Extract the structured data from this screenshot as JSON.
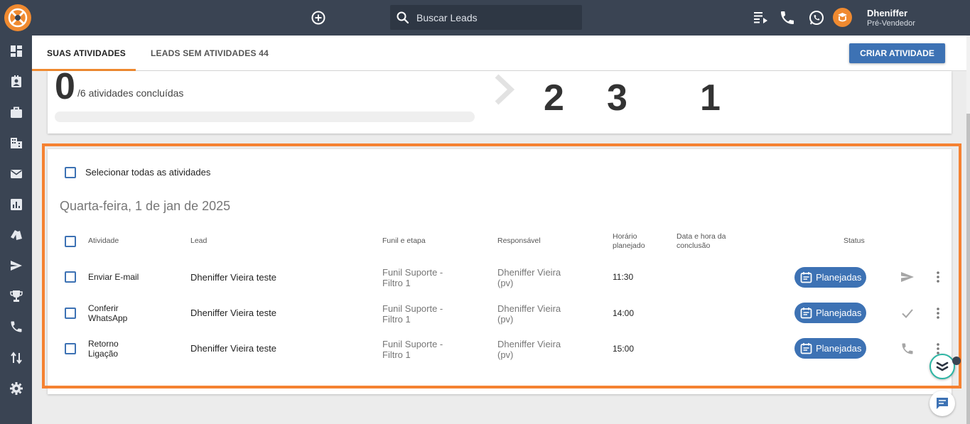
{
  "header": {
    "search_placeholder": "Buscar Leads",
    "user_name": "Dheniffer",
    "user_role": "Pré-Vendedor"
  },
  "sidebar": {
    "icons": [
      "dashboard-icon",
      "contacts-icon",
      "briefcase-icon",
      "building-icon",
      "mail-icon",
      "reports-icon",
      "tags-icon",
      "send-icon",
      "trophy-icon",
      "phone-icon",
      "transfer-icon",
      "settings-icon"
    ]
  },
  "tabs": {
    "activities": "SUAS ATIVIDADES",
    "leads_without": "LEADS SEM ATIVIDADES 44"
  },
  "create_button": "CRIAR ATIVIDADE",
  "summary": {
    "completed_count": "0",
    "completed_label": "/6 atividades concluídas",
    "progress_fraction": 0,
    "stats": [
      "2",
      "3",
      "1"
    ]
  },
  "list": {
    "select_all_label": "Selecionar todas as atividades",
    "date_heading": "Quarta-feira, 1 de jan de 2025",
    "columns": {
      "activity": "Atividade",
      "lead": "Lead",
      "funnel": "Funil e etapa",
      "owner": "Responsável",
      "planned_line1": "Horário",
      "planned_line2": "planejado",
      "completion_line1": "Data e hora da",
      "completion_line2": "conclusão",
      "status": "Status"
    },
    "rows": [
      {
        "activity_line1": "Enviar E-mail",
        "activity_line2": "",
        "lead": "Dheniffer Vieira teste",
        "funnel_line1": "Funil Suporte -",
        "funnel_line2": "Filtro 1",
        "owner_line1": "Dheniffer Vieira",
        "owner_line2": "(pv)",
        "time": "11:30",
        "status": "Planejadas",
        "action_icon": "send-icon"
      },
      {
        "activity_line1": "Conferir",
        "activity_line2": "WhatsApp",
        "lead": "Dheniffer Vieira teste",
        "funnel_line1": "Funil Suporte -",
        "funnel_line2": "Filtro 1",
        "owner_line1": "Dheniffer Vieira",
        "owner_line2": "(pv)",
        "time": "14:00",
        "status": "Planejadas",
        "action_icon": "check-icon"
      },
      {
        "activity_line1": "Retorno",
        "activity_line2": "Ligação",
        "lead": "Dheniffer Vieira teste",
        "funnel_line1": "Funil Suporte -",
        "funnel_line2": "Filtro 1",
        "owner_line1": "Dheniffer Vieira",
        "owner_line2": "(pv)",
        "time": "15:00",
        "status": "Planejadas",
        "action_icon": "phone-icon"
      }
    ]
  },
  "colors": {
    "topbar": "#3a4453",
    "accent": "#f08a30",
    "primary": "#3d72b4",
    "highlight": "#f58232"
  }
}
